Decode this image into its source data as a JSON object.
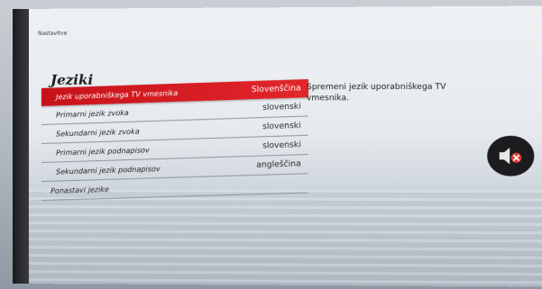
{
  "breadcrumb": "Nastavitve",
  "page_title": "Jeziki",
  "menu": [
    {
      "label": "Jezik uporabniškega TV vmesnika",
      "value": "Slovenščina",
      "selected": true
    },
    {
      "label": "Primarni jezik zvoka",
      "value": "slovenski"
    },
    {
      "label": "Sekundarni jezik zvoka",
      "value": "slovenski"
    },
    {
      "label": "Primarni jezik podnapisov",
      "value": "slovenski"
    },
    {
      "label": "Sekundarni jezik podnapisov",
      "value": "angleščina"
    },
    {
      "label": "Ponastavi jezike",
      "value": ""
    }
  ],
  "description": "Spremeni jezik uporabniškega TV vmesnika.",
  "icons": {
    "mute": "speaker-muted-icon"
  },
  "colors": {
    "accent": "#d41a20",
    "mute_x": "#e03a3a"
  }
}
